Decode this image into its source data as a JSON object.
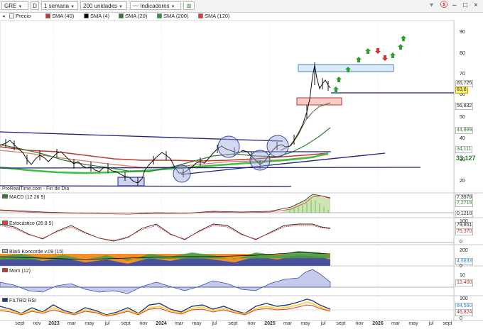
{
  "toolbar": {
    "ticker": "GRE",
    "d_button": "D",
    "period": "1 semana",
    "units": "200 unidades",
    "indicators": "Indicadores"
  },
  "legend": [
    {
      "label": "Precio",
      "color": "#ffffff"
    },
    {
      "label": "SMA (40)",
      "color": "#c0392b"
    },
    {
      "label": "SMA (4)",
      "color": "#000000"
    },
    {
      "label": "SMA (20)",
      "color": "#2e7d32"
    },
    {
      "label": "SMA (200)",
      "color": "#1e9e3a"
    },
    {
      "label": "SMA (120)",
      "color": "#e53935"
    }
  ],
  "price_axis": [
    "90",
    "80",
    "70",
    "60",
    "50",
    "40",
    "30",
    "20"
  ],
  "price_badges": {
    "last": "65,725",
    "close": "63,8",
    "sma4": "56,832",
    "sma20": "44,899",
    "sma40": "34,111",
    "sma200": "33,127"
  },
  "credit": "ProRealTime.com - Fin de Día",
  "panels": {
    "macd": {
      "label": "MACD (12 26 9)",
      "values": [
        "7,3978",
        "7,2719",
        "0,1210"
      ]
    },
    "stoch": {
      "label": "Estocástico (26 8 5)",
      "values": [
        "79,851",
        "75,370"
      ],
      "axis": [
        "100",
        "0"
      ]
    },
    "koncorde": {
      "label": "Blai5 Koncorde v.09 (15)",
      "values": [
        "4,6833"
      ],
      "axis": [
        "200",
        "0"
      ]
    },
    "mom": {
      "label": "Mom (12)",
      "values": [
        "12,400"
      ],
      "axis": [
        "10"
      ]
    },
    "rsi": {
      "label": "FILTRO RSI",
      "values": [
        "84,590",
        "46,824"
      ],
      "axis": [
        "100",
        "0"
      ]
    }
  },
  "months": [
    "sept",
    "nov",
    "2023",
    "mar",
    "may",
    "jul",
    "sept",
    "nov",
    "2024",
    "mar",
    "may",
    "jul",
    "sept",
    "nov",
    "2025",
    "mar",
    "may",
    "jul",
    "sept",
    "nov",
    "2026",
    "mar",
    "may",
    "jul",
    "sept"
  ],
  "arrows": [
    "up",
    "up",
    "up",
    "up",
    "up",
    "down",
    "down",
    "up",
    "up",
    "up"
  ],
  "colors": {
    "up_arrow": "#2e9e2e",
    "down_arrow": "#d32f2f",
    "channel": "#1a237e",
    "circle": "#7986cb"
  }
}
